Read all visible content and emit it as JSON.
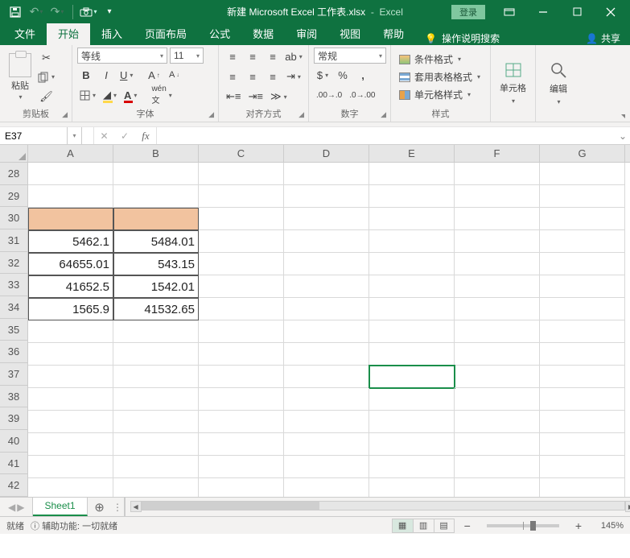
{
  "titlebar": {
    "doc_name": "新建 Microsoft Excel 工作表.xlsx",
    "app_name": "Excel",
    "login": "登录"
  },
  "tabs": {
    "file": "文件",
    "home": "开始",
    "insert": "插入",
    "layout": "页面布局",
    "formulas": "公式",
    "data": "数据",
    "review": "审阅",
    "view": "视图",
    "help": "帮助",
    "tellme": "操作说明搜索",
    "share": "共享"
  },
  "ribbon": {
    "clipboard": {
      "paste": "粘贴",
      "label": "剪贴板"
    },
    "font": {
      "name": "等线",
      "size": "11",
      "label": "字体"
    },
    "align": {
      "label": "对齐方式"
    },
    "number": {
      "format": "常规",
      "label": "数字"
    },
    "styles": {
      "cond": "条件格式",
      "tbl": "套用表格格式",
      "cell": "单元格样式",
      "label": "样式"
    },
    "cells": {
      "label": "单元格"
    },
    "edit": {
      "label": "编辑"
    }
  },
  "fbar": {
    "name": "E37",
    "formula": ""
  },
  "grid": {
    "cols": [
      "A",
      "B",
      "C",
      "D",
      "E",
      "F",
      "G"
    ],
    "row_start": 28,
    "row_end": 42,
    "highlight": {
      "row": 30,
      "cols": [
        "A",
        "B"
      ]
    },
    "border_region": {
      "rows": [
        30,
        34
      ],
      "cols": [
        "A",
        "B"
      ]
    },
    "data": {
      "31": {
        "A": "5462.1",
        "B": "5484.01"
      },
      "32": {
        "A": "64655.01",
        "B": "543.15"
      },
      "33": {
        "A": "41652.5",
        "B": "1542.01"
      },
      "34": {
        "A": "1565.9",
        "B": "41532.65"
      }
    },
    "selected": {
      "row": 37,
      "col": "E"
    }
  },
  "sheet": {
    "name": "Sheet1"
  },
  "status": {
    "ready": "就绪",
    "acc": "辅助功能: 一切就绪",
    "zoom": "145%"
  }
}
